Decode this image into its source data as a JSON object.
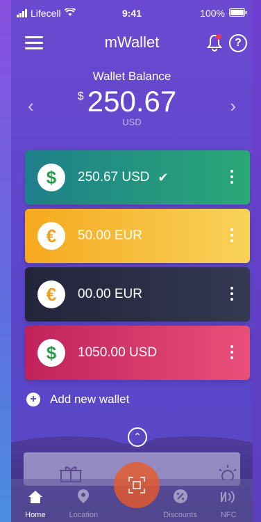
{
  "status": {
    "carrier": "Lifecell",
    "time": "9:41",
    "battery": "100%"
  },
  "header": {
    "title": "mWallet"
  },
  "balance": {
    "label": "Wallet Balance",
    "currency_symbol": "$",
    "amount": "250.67",
    "unit": "USD"
  },
  "wallets": [
    {
      "text": "250.67 USD",
      "symbol": "$",
      "symbol_color": "#2a9a4a",
      "selected": true,
      "check": "✔"
    },
    {
      "text": "50.00 EUR",
      "symbol": "€",
      "symbol_color": "#f0a020",
      "selected": false
    },
    {
      "text": "00.00 EUR",
      "symbol": "€",
      "symbol_color": "#f0a020",
      "selected": false
    },
    {
      "text": "1050.00 USD",
      "symbol": "$",
      "symbol_color": "#2a9a4a",
      "selected": false
    }
  ],
  "add_wallet": {
    "label": "Add new wallet"
  },
  "tabs": [
    {
      "label": "Home",
      "icon": "home-icon",
      "active": true
    },
    {
      "label": "Location",
      "icon": "location-pin-icon",
      "active": false
    },
    {
      "label": "",
      "icon": "scan-icon",
      "active": false
    },
    {
      "label": "Discounts",
      "icon": "discount-icon",
      "active": false
    },
    {
      "label": "NFC",
      "icon": "nfc-icon",
      "active": false
    }
  ],
  "colors": {
    "accent": "#5b45c9",
    "card_green": "#2a9a7a",
    "card_yellow": "#f6c23e",
    "card_dark": "#2f3145",
    "card_red": "#d73a6a",
    "scan_button": "#e85a28"
  }
}
